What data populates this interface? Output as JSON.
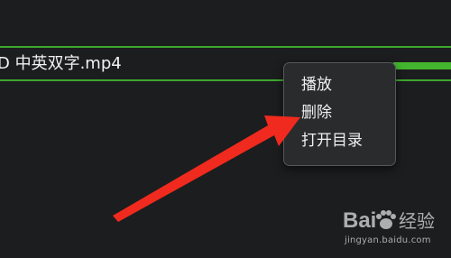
{
  "file_item": {
    "name": "D 中英双字.mp4",
    "progress_percent": 100
  },
  "context_menu": {
    "items": [
      {
        "label": "播放"
      },
      {
        "label": "删除"
      },
      {
        "label": "打开目录"
      }
    ]
  },
  "watermark": {
    "logo_text": "Bai 经验",
    "url": "jingyan.baidu.com"
  },
  "colors": {
    "background": "#1c1d1e",
    "accent_green": "#3ea82f",
    "annotation_red": "#f02a1e"
  },
  "icons": {
    "annotation": "red-arrow-icon",
    "brand": "baidu-paw-icon"
  }
}
